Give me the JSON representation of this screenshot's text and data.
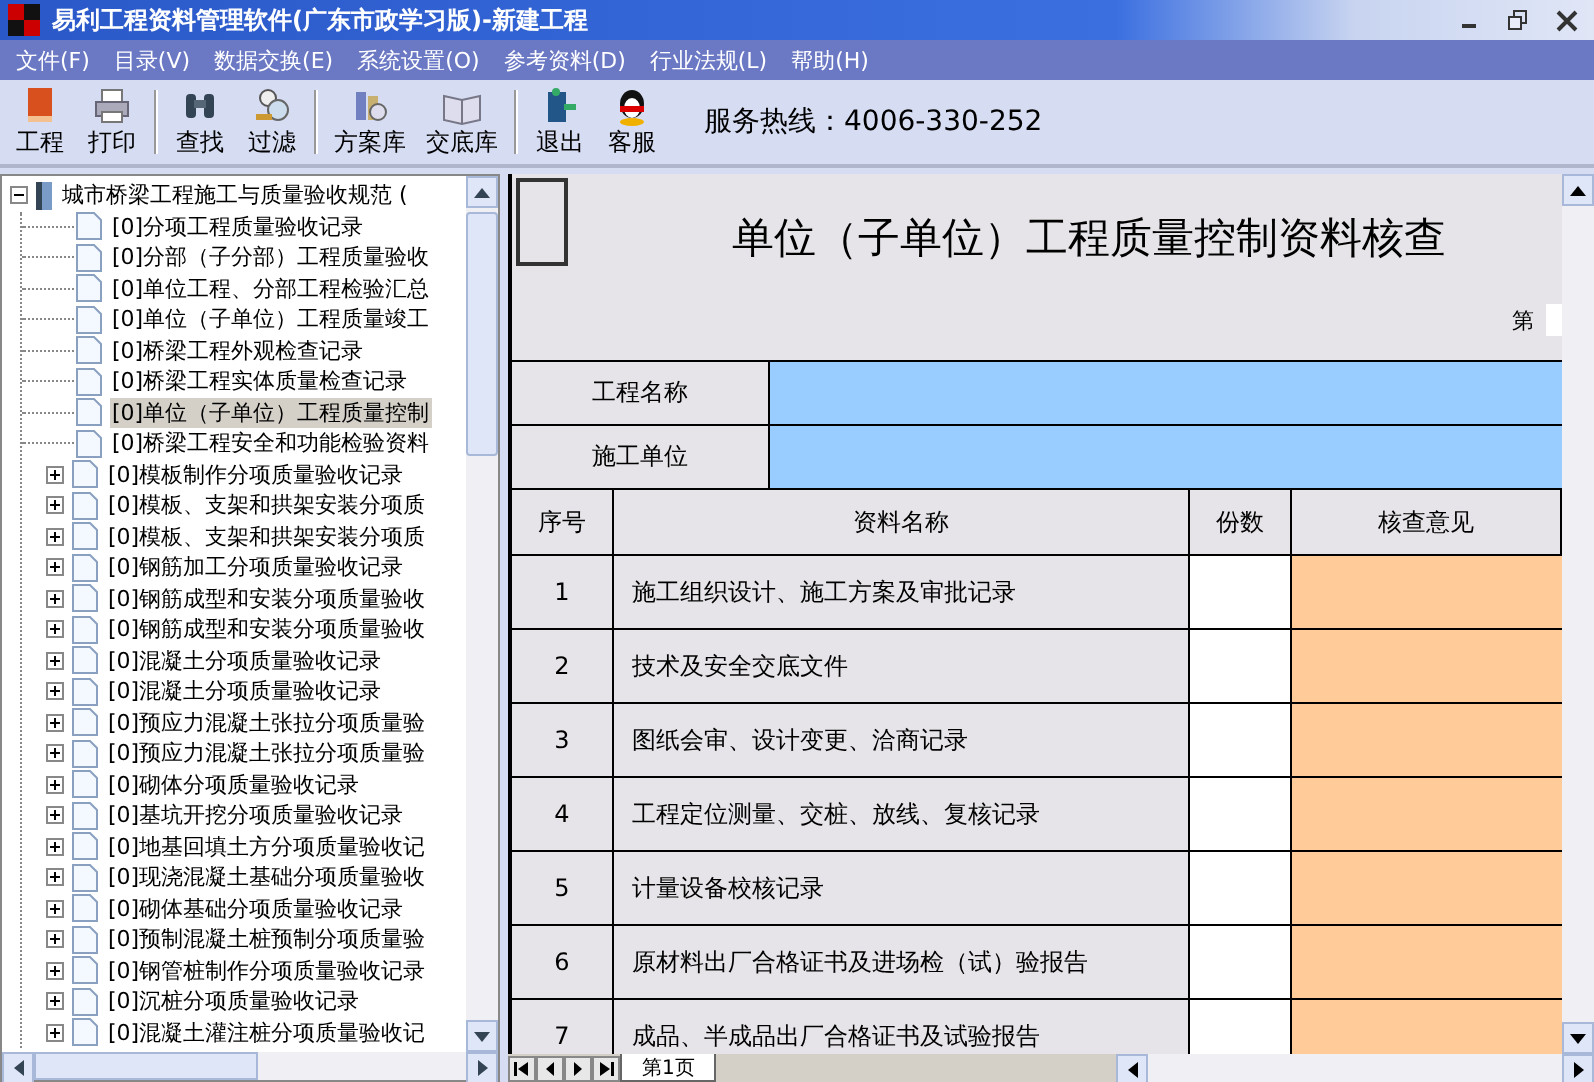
{
  "window": {
    "title": "易利工程资料管理软件(广东市政学习版)-新建工程"
  },
  "menu": [
    "文件(F)",
    "目录(V)",
    "数据交换(E)",
    "系统设置(O)",
    "参考资料(D)",
    "行业法规(L)",
    "帮助(H)"
  ],
  "toolbar": [
    [
      "工程",
      "打印"
    ],
    [
      "查找",
      "过滤"
    ],
    [
      "方案库",
      "交底库"
    ],
    [
      "退出",
      "客服"
    ]
  ],
  "hotline": "服务热线：4006-330-252",
  "tree": {
    "label": "城市桥梁工程施工与质量验收规范 (",
    "expanded": true,
    "selected": false,
    "children": [
      {
        "label": "[0]分项工程质量验收记录",
        "selected": false
      },
      {
        "label": "[0]分部（子分部）工程质量验收",
        "selected": false
      },
      {
        "label": "[0]单位工程、分部工程检验汇总",
        "selected": false
      },
      {
        "label": "[0]单位（子单位）工程质量竣工",
        "selected": false
      },
      {
        "label": "[0]桥梁工程外观检查记录",
        "selected": false
      },
      {
        "label": "[0]桥梁工程实体质量检查记录",
        "selected": false
      },
      {
        "label": "[0]单位（子单位）工程质量控制",
        "selected": true
      },
      {
        "label": "[0]桥梁工程安全和功能检验资料",
        "selected": false
      },
      {
        "label": "[0]模板制作分项质量验收记录",
        "expanded": false,
        "selected": false
      },
      {
        "label": "[0]模板、支架和拱架安装分项质",
        "expanded": false,
        "selected": false
      },
      {
        "label": "[0]模板、支架和拱架安装分项质",
        "expanded": false,
        "selected": false
      },
      {
        "label": "[0]钢筋加工分项质量验收记录",
        "expanded": false,
        "selected": false
      },
      {
        "label": "[0]钢筋成型和安装分项质量验收",
        "expanded": false,
        "selected": false
      },
      {
        "label": "[0]钢筋成型和安装分项质量验收",
        "expanded": false,
        "selected": false
      },
      {
        "label": "[0]混凝土分项质量验收记录",
        "expanded": false,
        "selected": false
      },
      {
        "label": "[0]混凝土分项质量验收记录",
        "expanded": false,
        "selected": false
      },
      {
        "label": "[0]预应力混凝土张拉分项质量验",
        "expanded": false,
        "selected": false
      },
      {
        "label": "[0]预应力混凝土张拉分项质量验",
        "expanded": false,
        "selected": false
      },
      {
        "label": "[0]砌体分项质量验收记录",
        "expanded": false,
        "selected": false
      },
      {
        "label": "[0]基坑开挖分项质量验收记录",
        "expanded": false,
        "selected": false
      },
      {
        "label": "[0]地基回填土方分项质量验收记",
        "expanded": false,
        "selected": false
      },
      {
        "label": "[0]现浇混凝土基础分项质量验收",
        "expanded": false,
        "selected": false
      },
      {
        "label": "[0]砌体基础分项质量验收记录",
        "expanded": false,
        "selected": false
      },
      {
        "label": "[0]预制混凝土桩预制分项质量验",
        "expanded": false,
        "selected": false
      },
      {
        "label": "[0]钢管桩制作分项质量验收记录",
        "expanded": false,
        "selected": false
      },
      {
        "label": "[0]沉桩分项质量验收记录",
        "expanded": false,
        "selected": false
      },
      {
        "label": "[0]混凝土灌注桩分项质量验收记",
        "expanded": false,
        "selected": false
      }
    ]
  },
  "sheet": {
    "title": "单位（子单位）工程质量控制资料核查",
    "page_label": "第",
    "info_rows": [
      "工程名称",
      "施工单位"
    ],
    "columns": [
      "序号",
      "资料名称",
      "份数",
      "核查意见"
    ],
    "rows": [
      {
        "no": "1",
        "name": "施工组织设计、施工方案及审批记录"
      },
      {
        "no": "2",
        "name": "技术及安全交底文件"
      },
      {
        "no": "3",
        "name": "图纸会审、设计变更、洽商记录"
      },
      {
        "no": "4",
        "name": "工程定位测量、交桩、放线、复核记录"
      },
      {
        "no": "5",
        "name": "计量设备校核记录"
      },
      {
        "no": "6",
        "name": "原材料出厂合格证书及进场检（试）验报告"
      },
      {
        "no": "7",
        "name": "成品、半成品出厂合格证书及试验报告"
      }
    ],
    "tabs": [
      {
        "label": "第1页",
        "selected": true
      }
    ]
  }
}
